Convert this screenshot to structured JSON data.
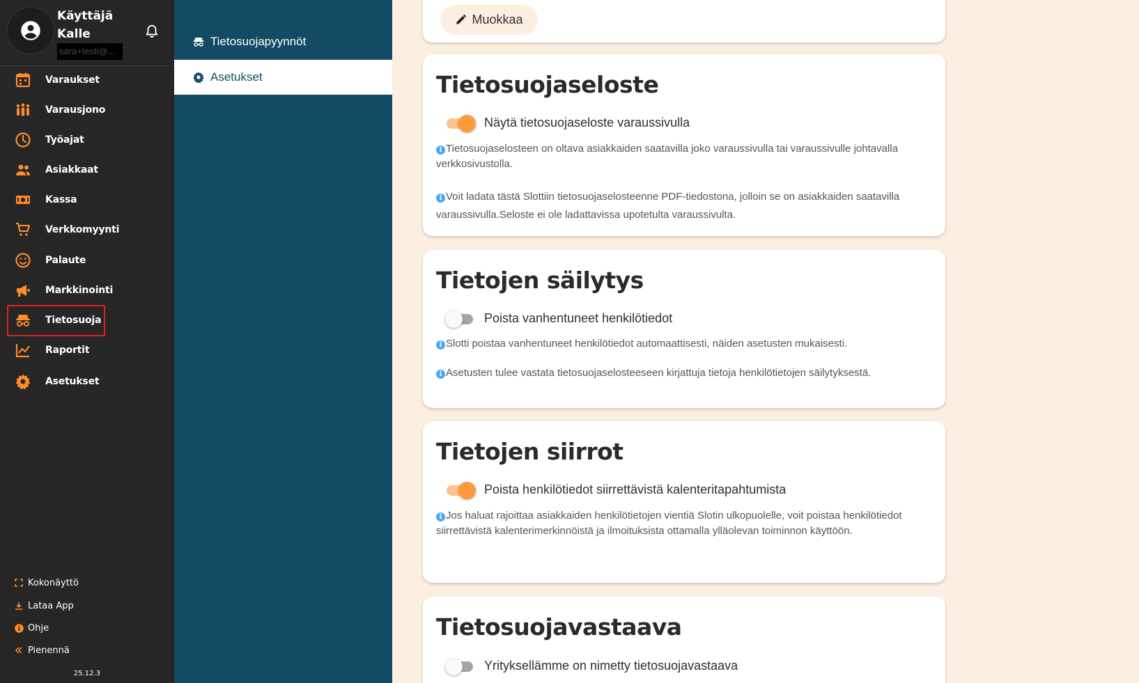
{
  "user": {
    "role": "Käyttäjä",
    "name": "Kalle",
    "email": "sara+testi@..."
  },
  "nav": [
    {
      "label": "Varaukset",
      "icon": "calendar-icon"
    },
    {
      "label": "Varausjono",
      "icon": "people-queue-icon"
    },
    {
      "label": "Työajat",
      "icon": "clock-icon"
    },
    {
      "label": "Asiakkaat",
      "icon": "customers-icon"
    },
    {
      "label": "Kassa",
      "icon": "cash-icon"
    },
    {
      "label": "Verkkomyynti",
      "icon": "cart-icon"
    },
    {
      "label": "Palaute",
      "icon": "smiley-icon"
    },
    {
      "label": "Markkinointi",
      "icon": "megaphone-icon"
    },
    {
      "label": "Tietosuoja",
      "icon": "incognito-icon"
    },
    {
      "label": "Raportit",
      "icon": "chart-icon"
    },
    {
      "label": "Asetukset",
      "icon": "gear-icon"
    }
  ],
  "bottom": [
    {
      "label": "Kokonäyttö",
      "icon": "fullscreen-icon"
    },
    {
      "label": "Lataa App",
      "icon": "download-icon"
    },
    {
      "label": "Ohje",
      "icon": "help-icon"
    },
    {
      "label": "Pienennä",
      "icon": "collapse-icon"
    }
  ],
  "version": "25.12.3",
  "subnav": [
    {
      "label": "Tietosuojapyynnöt",
      "icon": "incognito-icon"
    },
    {
      "label": "Asetukset",
      "icon": "gear-icon"
    }
  ],
  "edit_label": "Muokkaa",
  "cards": {
    "privacy_policy": {
      "title": "Tietosuojaseloste",
      "toggle_label": "Näytä tietosuojaseloste varaussivulla",
      "toggle_on": true,
      "info1": "Tietosuojaselosteen on oltava asiakkaiden saatavilla joko varaussivulla tai varaussivulle johtavalla verkkosivustolla.",
      "info2": "Voit ladata tästä Slottiin tietosuojaselosteenne PDF-tiedostona, jolloin se on asiakkaiden saatavilla varaussivulla.Seloste ei ole ladattavissa upotetulta varaussivulta."
    },
    "retention": {
      "title": "Tietojen säilytys",
      "toggle_label": "Poista vanhentuneet henkilötiedot",
      "toggle_on": false,
      "info1": "Slotti poistaa vanhentuneet henkilötiedot automaattisesti, näiden asetusten mukaisesti.",
      "info2": "Asetusten tulee vastata tietosuojaselosteeseen kirjattuja tietoja henkilötietojen säilytyksestä."
    },
    "transfers": {
      "title": "Tietojen siirrot",
      "toggle_label": "Poista henkilötiedot siirrettävistä kalenteritapahtumista",
      "toggle_on": true,
      "info1": "Jos haluat rajoittaa asiakkaiden henkilötietojen vientiä Slotin ulkopuolelle, voit poistaa henkilötiedot siirrettävistä kalenterimerkinnöistä ja ilmoituksista ottamalla ylläolevan toiminnon käyttöön."
    },
    "dpo": {
      "title": "Tietosuojavastaava",
      "toggle_label": "Yrityksellämme on nimetty tietosuojavastaava",
      "toggle_on": false
    }
  },
  "colors": {
    "accent": "#ff9a3c",
    "sidebar": "#262626",
    "subpanel": "#124b63",
    "background": "#fdeee2"
  }
}
